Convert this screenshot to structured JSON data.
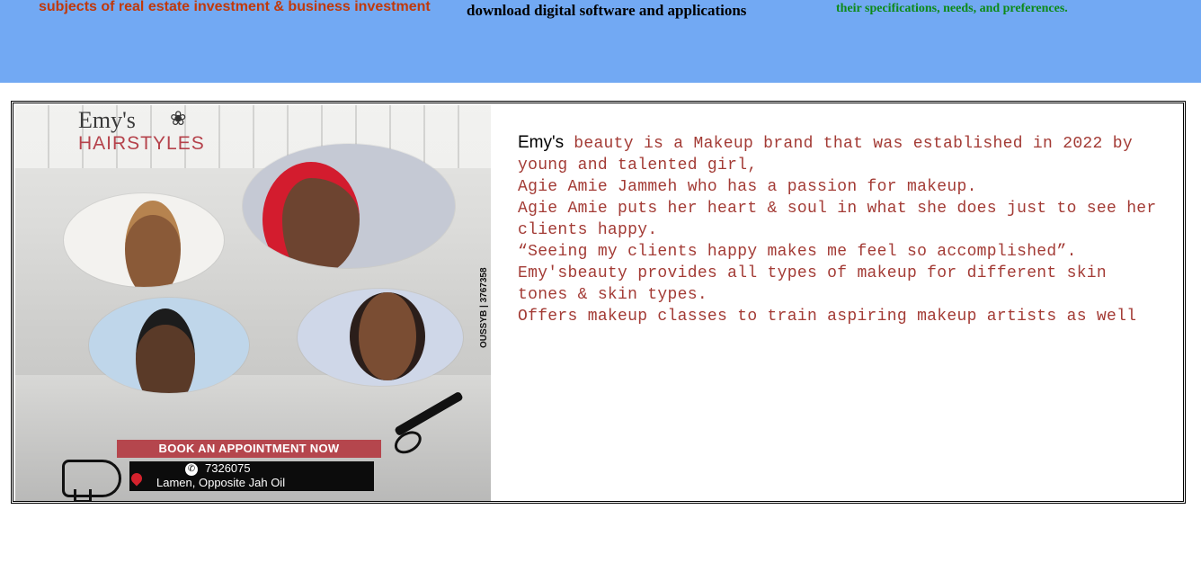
{
  "top_banner": {
    "col1": "subjects of real estate investment & business investment",
    "col2": "download digital software and applications",
    "col3": "their specifications, needs, and preferences."
  },
  "poster": {
    "logo_line1": "Emy's",
    "logo_line2": "HAIRSTYLES",
    "side_text": "OUSSYB | 3767358",
    "book_label": "BOOK AN APPOINTMENT NOW",
    "phone": "7326075",
    "address": "Lamen, Opposite Jah Oil"
  },
  "description": {
    "brand": "Emy's",
    "line1_rest": " beauty is a Makeup brand that was established in 2022 by young and talented girl,",
    "line2": "Agie Amie Jammeh who has a passion for makeup.",
    "line3": "Agie Amie puts her heart & soul in what she does just to see her clients happy.",
    "line4": "“Seeing my clients happy makes me feel so accomplished”.",
    "line5": "Emy'sbeauty provides all types of makeup for different skin tones & skin types.",
    "line6": "Offers makeup classes to train aspiring makeup artists as well"
  },
  "colors": {
    "banner_bg": "#72a9f3",
    "col1_text": "#c0390b",
    "col3_text": "#0d8a18",
    "desc_text": "#a33b35",
    "book_bar": "#b5464d"
  }
}
